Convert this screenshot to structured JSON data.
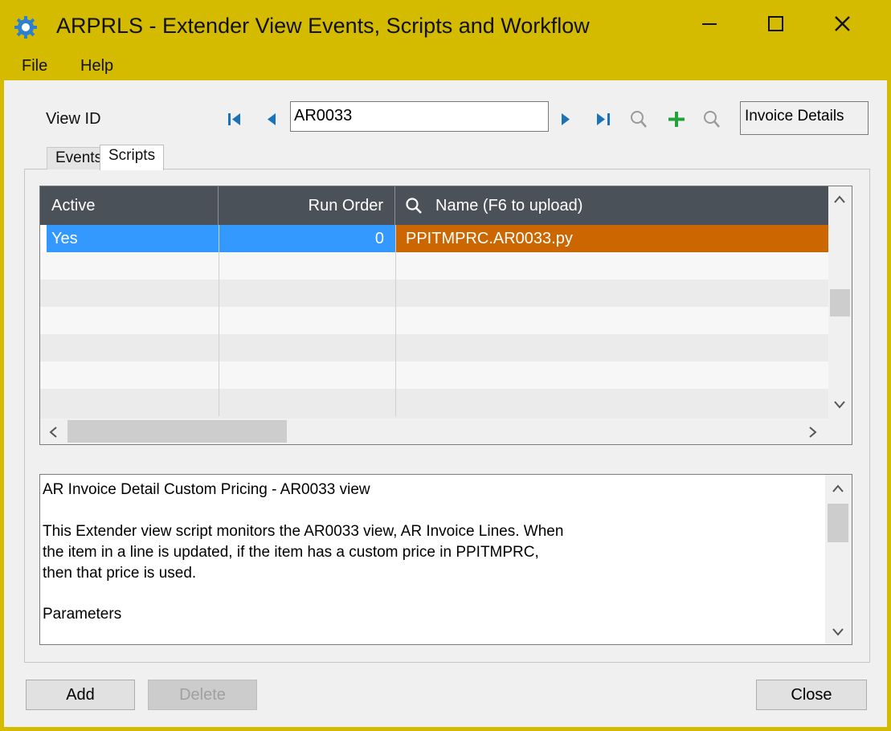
{
  "window": {
    "title": "ARPRLS - Extender View Events, Scripts and Workflow",
    "accent_color": "#d4bb00",
    "icons": [
      "gear-icon",
      "minimize-icon",
      "maximize-icon",
      "close-icon"
    ]
  },
  "menu": {
    "file": "File",
    "help": "Help"
  },
  "toolbar": {
    "view_id_label": "View ID",
    "view_id_value": "AR0033",
    "view_description": "Invoice Details",
    "icons": [
      "first-record-icon",
      "previous-record-icon",
      "next-record-icon",
      "last-record-icon",
      "finder-icon",
      "add-icon",
      "zoom-icon"
    ]
  },
  "tabs": [
    {
      "label": "Events",
      "active": false
    },
    {
      "label": "Scripts",
      "active": true
    }
  ],
  "grid": {
    "columns": [
      "Active",
      "Run Order",
      "Name (F6 to upload)"
    ],
    "rows": [
      {
        "active": "Yes",
        "run_order": "0",
        "name": "PPITMPRC.AR0033.py"
      }
    ],
    "selected_color": "#3399ff",
    "name_highlight_color": "#cc6600",
    "header_color": "#4b5159"
  },
  "script_text": {
    "lines": [
      "AR Invoice Detail Custom Pricing - AR0033 view",
      "",
      "This Extender view script monitors the AR0033 view, AR Invoice Lines. When",
      "the item in a line is updated, if the item has a custom price in PPITMPRC,",
      "then that price is used.",
      "",
      "Parameters"
    ]
  },
  "buttons": {
    "add": "Add",
    "delete": "Delete",
    "close": "Close"
  }
}
